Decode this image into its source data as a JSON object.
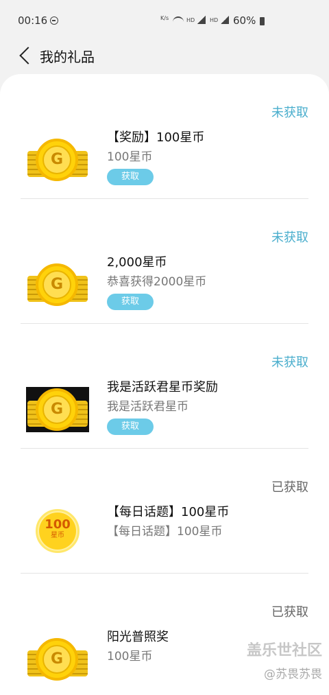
{
  "status_bar": {
    "time": "00:16",
    "speed": "K/s",
    "hd1": "HD",
    "hd2": "HD",
    "battery": "60%"
  },
  "header": {
    "title": "我的礼品"
  },
  "gifts": [
    {
      "status": "未获取",
      "title": "【奖励】100星币",
      "desc": "100星币",
      "button": "获取",
      "icon": "coin-stack-icon"
    },
    {
      "status": "未获取",
      "title": "2,000星币",
      "desc": "恭喜获得2000星币",
      "button": "获取",
      "icon": "coin-stack-icon"
    },
    {
      "status": "未获取",
      "title": "我是活跃君星币奖励",
      "desc": "我是活跃君星币",
      "button": "获取",
      "icon": "coin-stack-icon"
    },
    {
      "status": "已获取",
      "title": "【每日话题】100星币",
      "desc": "【每日话题】100星币",
      "icon": "coin-100-icon",
      "coin_num": "100",
      "coin_unit": "星币"
    },
    {
      "status": "已获取",
      "title": "阳光普照奖",
      "desc": "100星币",
      "icon": "coin-stack-icon"
    }
  ],
  "coin_letter": "G",
  "watermark": {
    "title": "盖乐世社区",
    "user": "@苏畏苏畏"
  },
  "colors": {
    "pending": "#4aaecd",
    "done": "#666666",
    "button": "#6ccbe8"
  }
}
